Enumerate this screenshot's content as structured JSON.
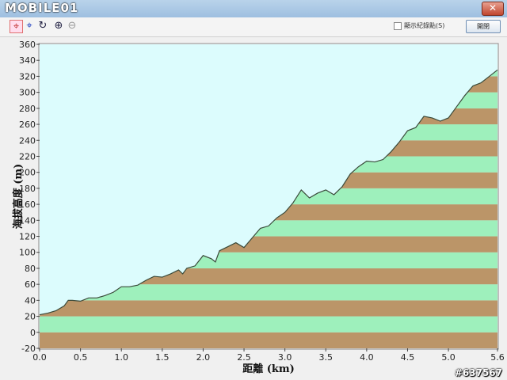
{
  "window": {
    "logo_text": "MOBILE01",
    "close_label": "✕"
  },
  "toolbar": {
    "tools": [
      {
        "name": "crosshair-red-tool-icon",
        "glyph": "⌖"
      },
      {
        "name": "crosshair-blue-tool-icon",
        "glyph": "⌖"
      },
      {
        "name": "lasso-tool-icon",
        "glyph": "↻"
      },
      {
        "name": "zoom-in-icon",
        "glyph": "⊕"
      },
      {
        "name": "zoom-out-icon",
        "glyph": "⊖"
      }
    ],
    "checkbox_label": "顯示紀錄點(S)",
    "open_button_label": "開閉"
  },
  "watermark": "#637567",
  "chart_data": {
    "type": "area",
    "title": "",
    "xlabel": "距離 (km)",
    "ylabel": "海拔高度 (m)",
    "xlim": [
      0,
      5.6
    ],
    "ylim": [
      -20,
      360
    ],
    "xticks": [
      "0.0",
      "0.5",
      "1.0",
      "1.5",
      "2.0",
      "2.5",
      "3.0",
      "3.5",
      "4.0",
      "4.5",
      "5.0",
      "5.6"
    ],
    "yticks": [
      "-20",
      "0",
      "20",
      "40",
      "60",
      "80",
      "100",
      "120",
      "140",
      "160",
      "180",
      "200",
      "220",
      "240",
      "260",
      "280",
      "300",
      "320",
      "340",
      "360"
    ],
    "band_colors": [
      "#bb9568",
      "#9ef0bc"
    ],
    "sky_color": "#dcfcfd",
    "profile": {
      "x": [
        0.0,
        0.1,
        0.2,
        0.3,
        0.35,
        0.4,
        0.5,
        0.6,
        0.7,
        0.8,
        0.9,
        1.0,
        1.1,
        1.2,
        1.3,
        1.4,
        1.5,
        1.6,
        1.7,
        1.75,
        1.8,
        1.9,
        2.0,
        2.1,
        2.15,
        2.2,
        2.3,
        2.4,
        2.5,
        2.6,
        2.7,
        2.8,
        2.9,
        3.0,
        3.1,
        3.2,
        3.3,
        3.4,
        3.5,
        3.6,
        3.7,
        3.8,
        3.9,
        4.0,
        4.1,
        4.2,
        4.3,
        4.4,
        4.5,
        4.6,
        4.7,
        4.8,
        4.9,
        5.0,
        5.1,
        5.2,
        5.3,
        5.4,
        5.5,
        5.6
      ],
      "y": [
        22,
        24,
        27,
        33,
        40,
        40,
        39,
        43,
        43,
        46,
        50,
        57,
        57,
        59,
        65,
        70,
        69,
        73,
        78,
        73,
        80,
        83,
        96,
        92,
        88,
        102,
        107,
        112,
        106,
        118,
        130,
        133,
        143,
        150,
        162,
        178,
        168,
        174,
        178,
        172,
        182,
        198,
        207,
        214,
        213,
        216,
        226,
        238,
        252,
        256,
        270,
        268,
        264,
        268,
        282,
        296,
        308,
        312,
        320,
        328
      ]
    }
  }
}
